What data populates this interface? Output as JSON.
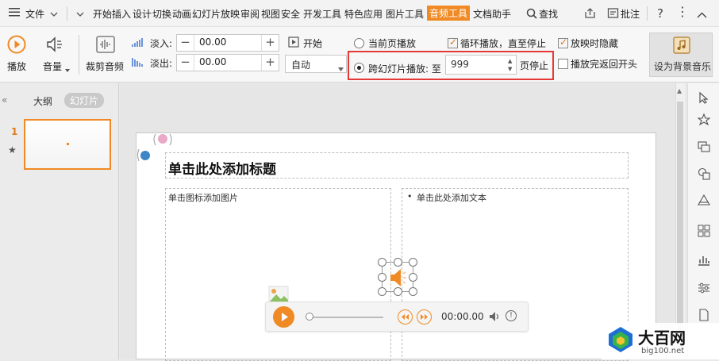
{
  "menu": {
    "file_label": "文件",
    "tabs": [
      "开始",
      "插入",
      "设计",
      "切换",
      "动画",
      "幻灯片放映",
      "审阅",
      "视图",
      "安全",
      "开发工具",
      "特色应用",
      "图片工具",
      "音频工具",
      "文档助手"
    ],
    "search_label": "查找",
    "comment_label": "批注",
    "active_tab": "音频工具"
  },
  "ribbon": {
    "play_label": "播放",
    "volume_label": "音量",
    "trim_label": "裁剪音频",
    "fade_in_label": "淡入:",
    "fade_in_value": "00.00",
    "fade_out_label": "淡出:",
    "fade_out_value": "00.00",
    "start_label": "开始",
    "start_select_value": "自动",
    "current_page_label": "当前页播放",
    "cross_slide_label": "跨幻灯片播放: 至",
    "cross_slide_value": "999",
    "stop_page_label": "页停止",
    "loop_label": "循环播放，直至停止",
    "hide_label": "放映时隐藏",
    "rewind_label": "播放完返回开头",
    "bg_music_label": "设为背景音乐"
  },
  "left_panel": {
    "tab_outline": "大纲",
    "tab_slides": "幻灯片",
    "slide_number": "1"
  },
  "slide": {
    "title_placeholder": "单击此处添加标题",
    "left_placeholder": "单击图标添加图片",
    "right_placeholder": "单击此处添加文本",
    "bullet": "•"
  },
  "player": {
    "time": "00:00.00"
  },
  "watermark": {
    "brand": "大百网",
    "url": "big100.net"
  },
  "colors": {
    "accent": "#f08a24",
    "highlight_box": "#e53935",
    "slide_thumb_border": "#f08a24"
  }
}
